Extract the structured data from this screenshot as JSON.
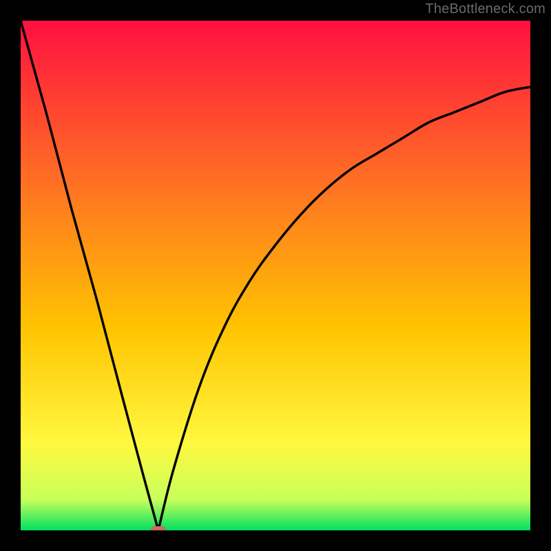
{
  "watermark": "TheBottleneck.com",
  "colors": {
    "frame": "#000000",
    "gradient_top": "#ff1040",
    "gradient_mid1": "#ff5a28",
    "gradient_mid2": "#ffc300",
    "gradient_mid3": "#fff840",
    "gradient_mid4": "#d8ff60",
    "gradient_bottom": "#00e060",
    "curve": "#000000",
    "marker": "#c96a66"
  },
  "chart_data": {
    "type": "line",
    "title": "",
    "xlabel": "",
    "ylabel": "",
    "xlim": [
      0,
      100
    ],
    "ylim": [
      0,
      100
    ],
    "notes": "V-shaped bottleneck curve; vertex at x≈27 where y≈0 (optimal / no bottleneck). Left branch rises nearly linearly to y≈100 at x=0. Right branch rises with decreasing slope, reaching y≈87 at x=100.",
    "series": [
      {
        "name": "left-branch",
        "x": [
          0,
          5,
          10,
          15,
          20,
          24,
          27
        ],
        "values": [
          100,
          82,
          63,
          45,
          26,
          11,
          0
        ]
      },
      {
        "name": "right-branch",
        "x": [
          27,
          30,
          35,
          40,
          45,
          50,
          55,
          60,
          65,
          70,
          75,
          80,
          85,
          90,
          95,
          100
        ],
        "values": [
          0,
          12,
          28,
          40,
          49,
          56,
          62,
          67,
          71,
          74,
          77,
          80,
          82,
          84,
          86,
          87
        ]
      }
    ],
    "marker": {
      "x": 27,
      "y": 0,
      "shape": "rounded-rect",
      "color": "#c96a66"
    }
  }
}
